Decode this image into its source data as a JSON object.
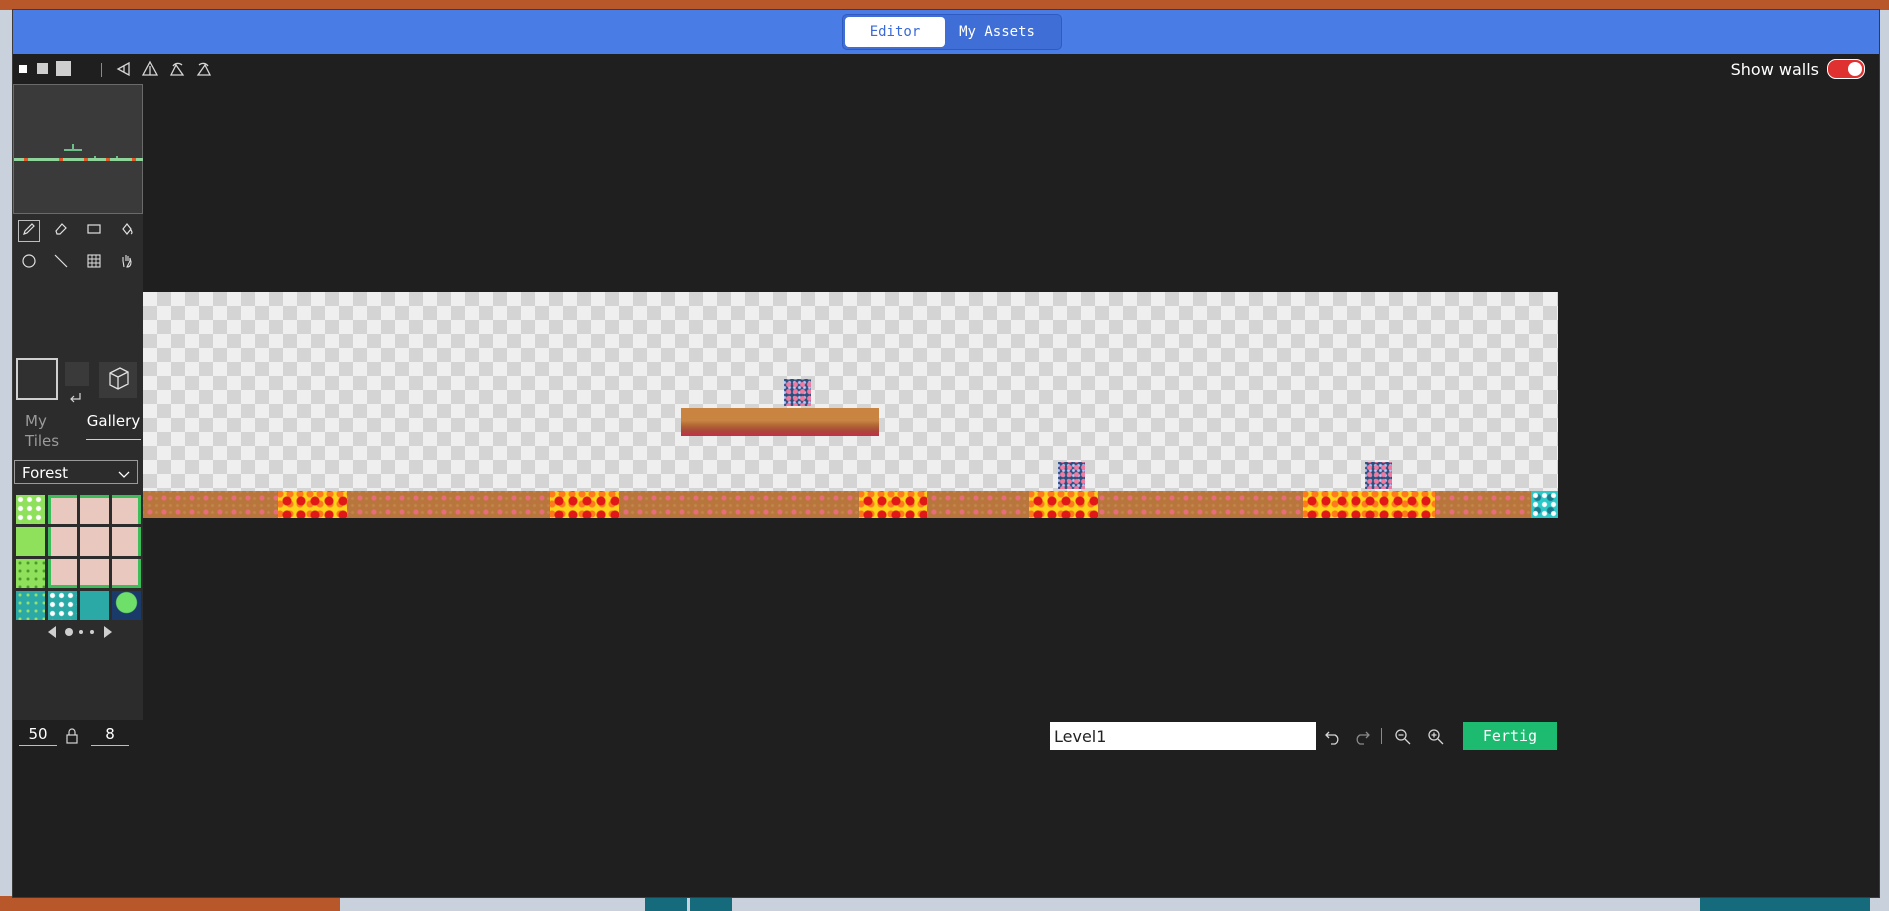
{
  "header": {
    "tabs": [
      {
        "label": "Editor",
        "active": true
      },
      {
        "label": "My Assets",
        "active": false
      }
    ]
  },
  "toolstrip": {
    "sizes": [
      "small",
      "medium",
      "large"
    ],
    "transform_icons": [
      "flip-horizontal-icon",
      "flip-vertical-icon",
      "rotate-left-icon",
      "rotate-right-icon"
    ],
    "show_walls_label": "Show walls",
    "show_walls_on": true
  },
  "sidebar": {
    "tools": [
      "pencil-icon",
      "eraser-icon",
      "rectangle-icon",
      "fill-bucket-icon",
      "circle-icon",
      "line-icon",
      "grid-select-icon",
      "hand-icon"
    ],
    "tabs": {
      "my_tiles": "My Tiles",
      "gallery": "Gallery"
    },
    "tileset": "Forest",
    "page_count": 3,
    "current_page": 1
  },
  "bottom": {
    "grid_size": "50",
    "lock_icon": "lock-icon",
    "brush_size": "8",
    "level_name": "Level1",
    "done_label": "Fertig"
  },
  "colors": {
    "header": "#4a7ce6",
    "done": "#1dbb70",
    "toggle_on": "#e03131"
  }
}
